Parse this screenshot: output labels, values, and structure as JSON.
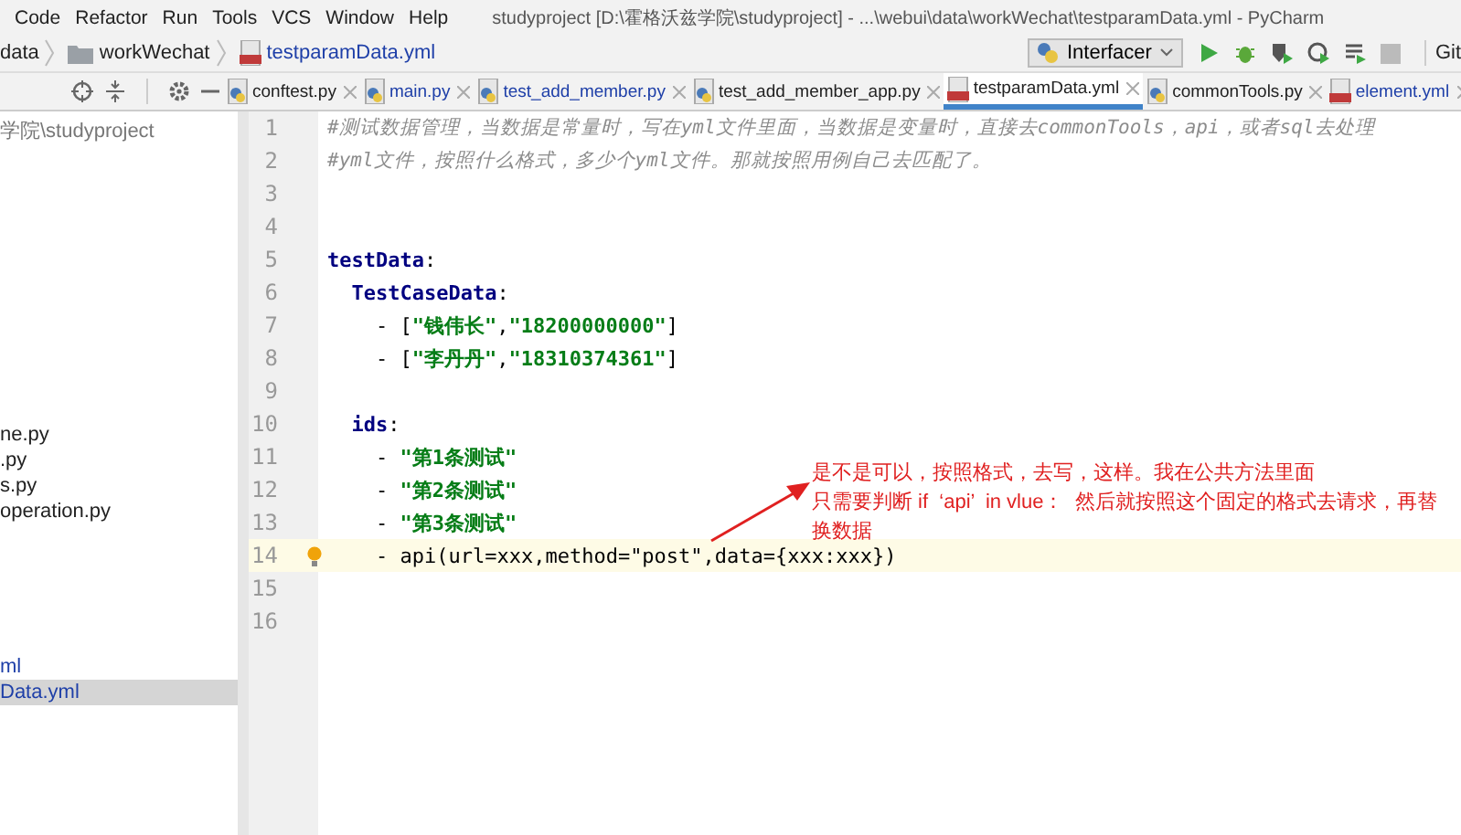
{
  "menu": [
    "Code",
    "Refactor",
    "Run",
    "Tools",
    "VCS",
    "Window",
    "Help"
  ],
  "window": {
    "title": "studyproject [D:\\霍格沃兹学院\\studyproject] - ...\\webui\\data\\workWechat\\testparamData.yml - PyCharm"
  },
  "breadcrumb": [
    {
      "label": "data",
      "kind": "plain"
    },
    {
      "label": "workWechat",
      "kind": "folder"
    },
    {
      "label": "testparamData.yml",
      "kind": "yml"
    }
  ],
  "run_config": {
    "label": "Interfacer"
  },
  "toolbar_text": "Git",
  "tabs": [
    {
      "label": "conftest.py",
      "kind": "py",
      "modified": false,
      "selected": false
    },
    {
      "label": "main.py",
      "kind": "py",
      "modified": true,
      "selected": false
    },
    {
      "label": "test_add_member.py",
      "kind": "py",
      "modified": true,
      "selected": false
    },
    {
      "label": "test_add_member_app.py",
      "kind": "py",
      "modified": false,
      "selected": false
    },
    {
      "label": "testparamData.yml",
      "kind": "yml",
      "modified": false,
      "selected": true
    },
    {
      "label": "commonTools.py",
      "kind": "py",
      "modified": false,
      "selected": false
    },
    {
      "label": "element.yml",
      "kind": "yml",
      "modified": true,
      "selected": false
    }
  ],
  "sidebar": {
    "header": "学院\\studyproject",
    "items": [
      {
        "label": "ne.py",
        "selected": false,
        "modified": false
      },
      {
        "label": ".py",
        "selected": false,
        "modified": false
      },
      {
        "label": "s.py",
        "selected": false,
        "modified": false
      },
      {
        "label": "operation.py",
        "selected": false,
        "modified": false
      },
      {
        "label": "ml",
        "selected": false,
        "modified": true
      },
      {
        "label": "Data.yml",
        "selected": true,
        "modified": true
      }
    ]
  },
  "code": [
    {
      "number": "1",
      "current": false,
      "tokens": [
        {
          "kind": "comment",
          "text": "#测试数据管理，当数据是常量时，写在yml文件里面，当数据是变量时，直接去commonTools，api，或者sql去处理"
        }
      ]
    },
    {
      "number": "2",
      "current": false,
      "tokens": [
        {
          "kind": "comment",
          "text": "#yml文件，按照什么格式，多少个yml文件。那就按照用例自己去匹配了。"
        }
      ]
    },
    {
      "number": "3",
      "current": false
    },
    {
      "number": "4",
      "current": false
    },
    {
      "number": "5",
      "current": false,
      "tokens": [
        {
          "kind": "key",
          "text": "testData"
        },
        {
          "kind": "plain",
          "text": ":"
        }
      ]
    },
    {
      "number": "6",
      "current": false,
      "tokens": [
        {
          "kind": "key",
          "text": "  TestCaseData"
        },
        {
          "kind": "plain",
          "text": ":"
        }
      ]
    },
    {
      "number": "7",
      "current": false,
      "tokens": [
        {
          "kind": "plain",
          "text": "    - ["
        },
        {
          "kind": "string",
          "text": "\"钱伟长\""
        },
        {
          "kind": "plain",
          "text": ","
        },
        {
          "kind": "string",
          "text": "\"18200000000\""
        },
        {
          "kind": "plain",
          "text": "]"
        }
      ]
    },
    {
      "number": "8",
      "current": false,
      "tokens": [
        {
          "kind": "plain",
          "text": "    - ["
        },
        {
          "kind": "string",
          "text": "\"李丹丹\""
        },
        {
          "kind": "plain",
          "text": ","
        },
        {
          "kind": "string",
          "text": "\"18310374361\""
        },
        {
          "kind": "plain",
          "text": "]"
        }
      ]
    },
    {
      "number": "9",
      "current": false
    },
    {
      "number": "10",
      "current": false,
      "tokens": [
        {
          "kind": "key",
          "text": "  ids"
        },
        {
          "kind": "plain",
          "text": ":"
        }
      ]
    },
    {
      "number": "11",
      "current": false,
      "tokens": [
        {
          "kind": "plain",
          "text": "    - "
        },
        {
          "kind": "string",
          "text": "\"第1条测试\""
        }
      ]
    },
    {
      "number": "12",
      "current": false,
      "tokens": [
        {
          "kind": "plain",
          "text": "    - "
        },
        {
          "kind": "string",
          "text": "\"第2条测试\""
        }
      ]
    },
    {
      "number": "13",
      "current": false,
      "tokens": [
        {
          "kind": "plain",
          "text": "    - "
        },
        {
          "kind": "string",
          "text": "\"第3条测试\""
        }
      ]
    },
    {
      "number": "14",
      "current": true,
      "tokens": [
        {
          "kind": "plain",
          "text": "    - api(url=xxx,method=\"post\",data={xxx:xxx})"
        }
      ]
    },
    {
      "number": "15",
      "current": false
    },
    {
      "number": "16",
      "current": false
    }
  ],
  "annotation": [
    "是不是可以，按照格式，去写，这样。我在公共方法里面",
    "只需要判断 if  ‘api’  in vlue：  然后就按照这个固定的格式去请求，再替换数据"
  ]
}
